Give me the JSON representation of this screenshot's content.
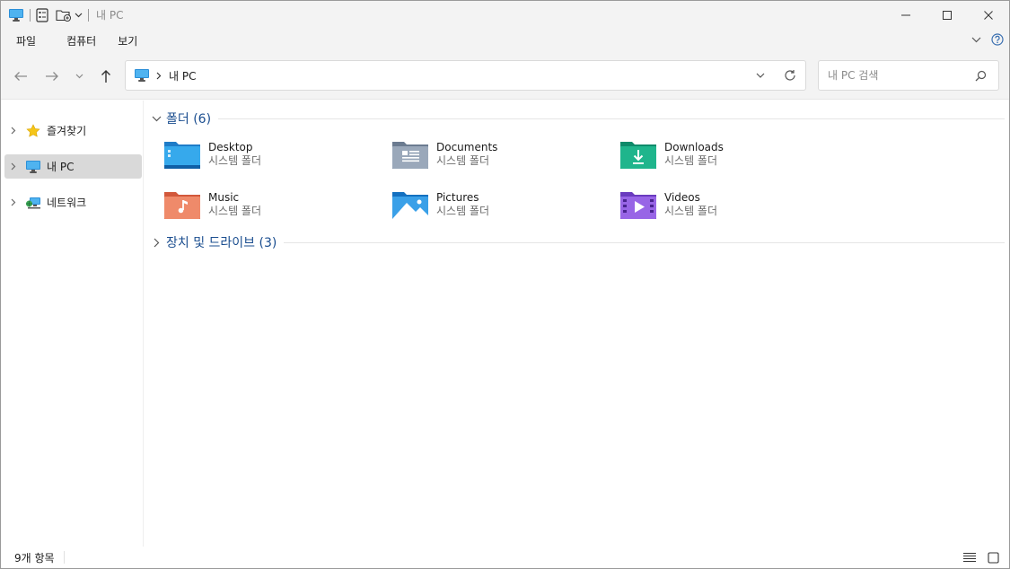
{
  "window": {
    "title": "내 PC"
  },
  "menu": {
    "items": [
      "파일",
      "컴퓨터",
      "보기"
    ]
  },
  "address": {
    "path": "내 PC"
  },
  "search": {
    "placeholder": "내 PC 검색"
  },
  "sidebar": {
    "items": [
      {
        "label": "즐겨찾기",
        "icon": "star-icon",
        "selected": false
      },
      {
        "label": "내 PC",
        "icon": "computer-icon",
        "selected": true
      },
      {
        "label": "네트워크",
        "icon": "network-icon",
        "selected": false
      }
    ]
  },
  "groups": {
    "folders": {
      "title": "폴더",
      "count": "(6)"
    },
    "drives": {
      "title": "장치 및 드라이브",
      "count": "(3)"
    }
  },
  "folders": [
    {
      "name": "Desktop",
      "type": "시스템 폴더",
      "icon": "desktop-folder-icon"
    },
    {
      "name": "Documents",
      "type": "시스템 폴더",
      "icon": "documents-folder-icon"
    },
    {
      "name": "Downloads",
      "type": "시스템 폴더",
      "icon": "downloads-folder-icon"
    },
    {
      "name": "Music",
      "type": "시스템 폴더",
      "icon": "music-folder-icon"
    },
    {
      "name": "Pictures",
      "type": "시스템 폴더",
      "icon": "pictures-folder-icon"
    },
    {
      "name": "Videos",
      "type": "시스템 폴더",
      "icon": "videos-folder-icon"
    }
  ],
  "status": {
    "item_count": "9개 항목"
  },
  "colors": {
    "accent": "#1a4d8f",
    "selection": "#d9d9d9",
    "chrome": "#f3f3f3"
  }
}
